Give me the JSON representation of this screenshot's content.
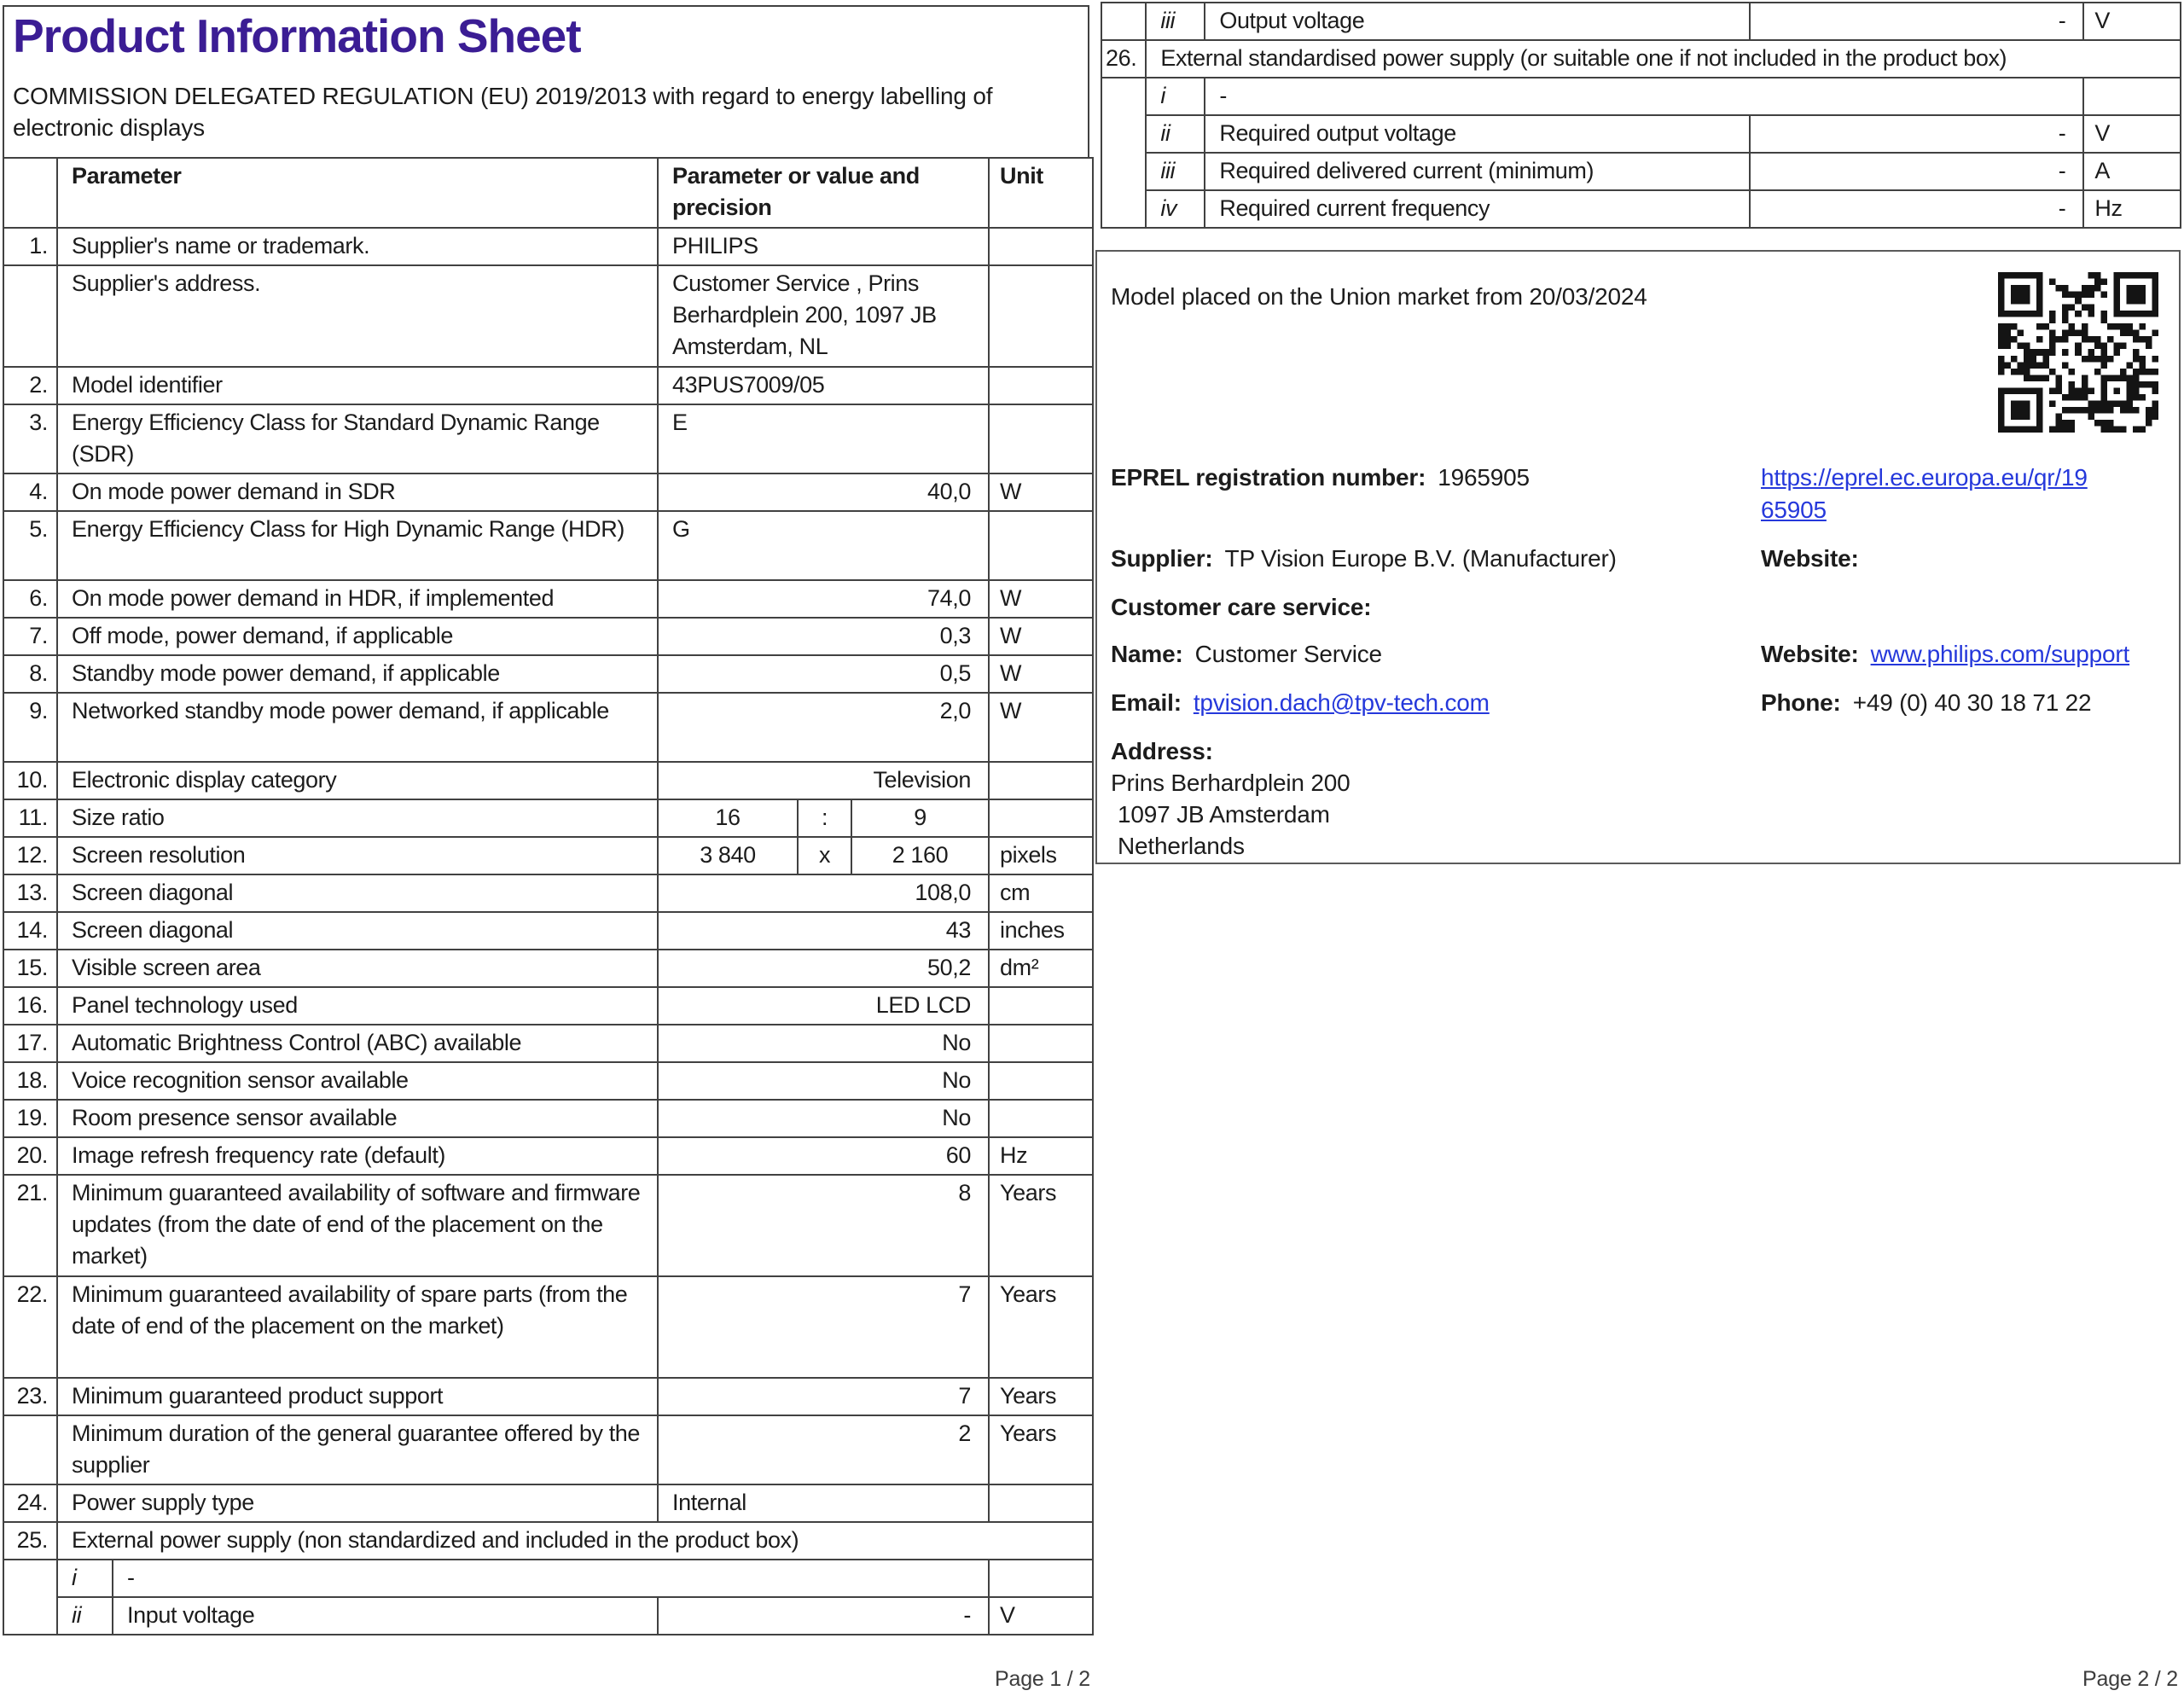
{
  "colors": {
    "title_purple": "#3b1d94",
    "link_blue": "#2538db",
    "table_border": "#414141",
    "text": "#1c1c1c"
  },
  "page1": {
    "title": "Product Information Sheet",
    "subtitle": "COMMISSION DELEGATED REGULATION (EU) 2019/2013 with regard to energy labelling of electronic displays",
    "footer": "Page 1 / 2",
    "table": {
      "headers": {
        "parameter": "Parameter",
        "value": "Parameter or value and precision",
        "unit": "Unit"
      },
      "rows": [
        {
          "type": "std",
          "num": "1.",
          "label": "Supplier's name or trademark.",
          "value": "PHILIPS",
          "align": "l",
          "unit": "",
          "h": 1
        },
        {
          "type": "std",
          "num": "",
          "label": "Supplier's address.",
          "value": "Customer Service , Prins Berhardplein 200, 1097 JB Amsterdam, NL",
          "align": "l",
          "unit": "",
          "h": 3
        },
        {
          "type": "std",
          "num": "2.",
          "label": "Model identifier",
          "value": "43PUS7009/05",
          "align": "l",
          "unit": "",
          "h": 1
        },
        {
          "type": "std",
          "num": "3.",
          "label": "Energy Efficiency Class for Standard Dynamic Range (SDR)",
          "value": "E",
          "align": "l",
          "unit": "",
          "h": 2
        },
        {
          "type": "std",
          "num": "4.",
          "label": "On mode power demand in SDR",
          "value": "40,0",
          "align": "r",
          "unit": "W",
          "h": 1
        },
        {
          "type": "std",
          "num": "5.",
          "label": "Energy Efficiency Class for High Dynamic Range (HDR)",
          "value": "G",
          "align": "l",
          "unit": "",
          "h": 2
        },
        {
          "type": "std",
          "num": "6.",
          "label": "On mode power demand in HDR, if implemented",
          "value": "74,0",
          "align": "r",
          "unit": "W",
          "h": 1
        },
        {
          "type": "std",
          "num": "7.",
          "label": "Off mode, power demand, if applicable",
          "value": "0,3",
          "align": "r",
          "unit": "W",
          "h": 1
        },
        {
          "type": "std",
          "num": "8.",
          "label": "Standby mode power demand, if applicable",
          "value": "0,5",
          "align": "r",
          "unit": "W",
          "h": 1
        },
        {
          "type": "std",
          "num": "9.",
          "label": "Networked standby mode power demand, if applicable",
          "value": "2,0",
          "align": "r",
          "unit": "W",
          "h": 2
        },
        {
          "type": "std",
          "num": "10.",
          "label": "Electronic display category",
          "value": "Television",
          "align": "r",
          "unit": "",
          "h": 1
        },
        {
          "type": "split",
          "num": "11.",
          "label": "Size ratio",
          "parts": [
            "16",
            ":",
            "9"
          ],
          "unit": "",
          "h": 1
        },
        {
          "type": "split",
          "num": "12.",
          "label": "Screen resolution",
          "parts": [
            "3 840",
            "x",
            "2 160"
          ],
          "unit": "pixels",
          "h": 1
        },
        {
          "type": "std",
          "num": "13.",
          "label": "Screen diagonal",
          "value": "108,0",
          "align": "r",
          "unit": "cm",
          "h": 1
        },
        {
          "type": "std",
          "num": "14.",
          "label": "Screen diagonal",
          "value": "43",
          "align": "r",
          "unit": "inches",
          "h": 1
        },
        {
          "type": "std",
          "num": "15.",
          "label": "Visible screen area",
          "value": "50,2",
          "align": "r",
          "unit": "dm²",
          "h": 1
        },
        {
          "type": "std",
          "num": "16.",
          "label": "Panel technology used",
          "value": "LED LCD",
          "align": "r",
          "unit": "",
          "h": 1
        },
        {
          "type": "std",
          "num": "17.",
          "label": "Automatic Brightness Control (ABC) available",
          "value": "No",
          "align": "r",
          "unit": "",
          "h": 1
        },
        {
          "type": "std",
          "num": "18.",
          "label": "Voice recognition sensor available",
          "value": "No",
          "align": "r",
          "unit": "",
          "h": 1
        },
        {
          "type": "std",
          "num": "19.",
          "label": "Room presence sensor available",
          "value": "No",
          "align": "r",
          "unit": "",
          "h": 1
        },
        {
          "type": "std",
          "num": "20.",
          "label": "Image refresh frequency rate (default)",
          "value": "60",
          "align": "r",
          "unit": "Hz",
          "h": 1
        },
        {
          "type": "std",
          "num": "21.",
          "label": "Minimum guaranteed availability of software and firmware updates (from the date of end of the placement on the market)",
          "value": "8",
          "align": "r",
          "unit": "Years",
          "h": 3
        },
        {
          "type": "std",
          "num": "22.",
          "label": "Minimum guaranteed availability of spare parts (from the date of end of the placement on the market)",
          "value": "7",
          "align": "r",
          "unit": "Years",
          "h": 3
        },
        {
          "type": "std",
          "num": "23.",
          "label": "Minimum guaranteed product support",
          "value": "7",
          "align": "r",
          "unit": "Years",
          "h": 1
        },
        {
          "type": "std",
          "num": "",
          "label": "Minimum duration of the general guarantee offered by the supplier",
          "value": "2",
          "align": "r",
          "unit": "Years",
          "h": 2
        },
        {
          "type": "std",
          "num": "24.",
          "label": "Power supply type",
          "value": "Internal",
          "align": "l",
          "unit": "",
          "h": 1
        },
        {
          "type": "section",
          "num": "25.",
          "label": "External power supply (non standardized and included in the product box)",
          "h": 1
        },
        {
          "type": "sub-merged",
          "roman": "i",
          "value": "-",
          "span": 2,
          "h": 1
        },
        {
          "type": "sub",
          "roman": "ii",
          "label": "Input voltage",
          "value": "-",
          "unit": "V",
          "h": 1
        }
      ]
    }
  },
  "page2": {
    "footer": "Page 2 / 2",
    "table": {
      "rows": [
        {
          "type": "sub-top",
          "roman": "iii",
          "label": "Output voltage",
          "value": "-",
          "unit": "V",
          "h": 1
        },
        {
          "type": "section",
          "num": "26.",
          "label": "External standardised power supply (or suitable one if not included in the product box)",
          "h": 1
        },
        {
          "type": "sub-merged",
          "roman": "i",
          "value": "-",
          "span": 4,
          "h": 1
        },
        {
          "type": "sub",
          "roman": "ii",
          "label": "Required output voltage",
          "value": "-",
          "unit": "V",
          "h": 1
        },
        {
          "type": "sub",
          "roman": "iii",
          "label": "Required delivered current (minimum)",
          "value": "-",
          "unit": "A",
          "h": 1
        },
        {
          "type": "sub",
          "roman": "iv",
          "label": "Required current frequency",
          "value": "-",
          "unit": "Hz",
          "h": 1
        }
      ]
    },
    "info": {
      "model_line": "Model placed on the Union market from 20/03/2024",
      "eprel_label": "EPREL registration number:",
      "eprel_value": "1965905",
      "eprel_link_lines": [
        "https://eprel.ec.europa.eu/qr/19",
        "65905"
      ],
      "supplier_label": "Supplier:",
      "supplier_value": "TP Vision Europe B.V. (Manufacturer)",
      "website_label": "Website:",
      "customer_care_label": "Customer care service:",
      "name_label": "Name:",
      "name_value": "Customer Service",
      "website2_label": "Website:",
      "website2_value": "www.philips.com/support",
      "email_label": "Email:",
      "email_value": "tpvision.dach@tpv-tech.com",
      "phone_label": "Phone:",
      "phone_value": "+49 (0) 40 30 18 71 22",
      "address_label": "Address:",
      "address_lines": [
        "Prins Berhardplein 200",
        "1097 JB Amsterdam",
        "Netherlands"
      ]
    }
  }
}
